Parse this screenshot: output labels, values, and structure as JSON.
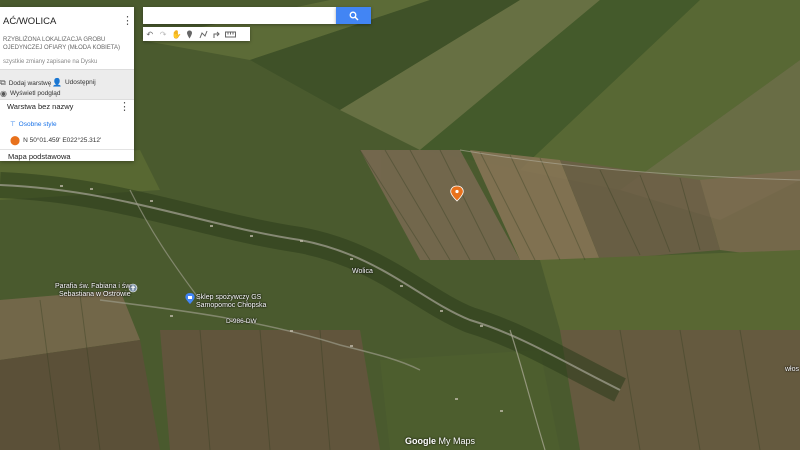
{
  "panel": {
    "title": "AĆ/WOLICA",
    "description_lines": [
      "RZYBLIŻONA LOKALIZACJA GROBU",
      "OJEDYNCZEJ OFIARY (MŁODA KOBIETA)"
    ],
    "saved_status": "szystkie zmiany zapisane na Dysku",
    "add_layer_label": "Dodaj warstwę",
    "share_label": "Udostępnij",
    "preview_label": "Wyświetl podgląd",
    "layer": {
      "name": "Warstwa bez nazwy",
      "style_label": "Osobne style",
      "point_label": "N 50°01.459' E022°25.312'"
    },
    "basemap_label": "Mapa podstawowa"
  },
  "search": {
    "value": "",
    "placeholder": ""
  },
  "toolbar": {
    "tools": [
      {
        "name": "undo-icon",
        "glyph": "↶",
        "enabled": true
      },
      {
        "name": "redo-icon",
        "glyph": "↷",
        "enabled": false
      },
      {
        "name": "hand-pan-icon",
        "glyph": "✋",
        "enabled": true
      },
      {
        "name": "marker-add-icon",
        "glyph": "⚲",
        "enabled": true
      },
      {
        "name": "draw-line-icon",
        "glyph": "ᔕ",
        "enabled": true
      },
      {
        "name": "directions-icon",
        "glyph": "↱",
        "enabled": true
      },
      {
        "name": "ruler-icon",
        "glyph": "▭",
        "enabled": true
      },
      {
        "name": "measure-extra-icon",
        "glyph": "",
        "enabled": true
      }
    ]
  },
  "map_labels": {
    "village": "Wolica",
    "church_line1": "Parafia św. Fabiana i św.",
    "church_line2": "Sebastiana w Ostrowie",
    "shop_line1": "Sklep spożywczy GS",
    "shop_line2": "Samopomoc Chłopska",
    "road_number": "D-986-DW",
    "right_edge": "włos"
  },
  "watermark": {
    "brand": "Google",
    "product": "My Maps"
  },
  "colors": {
    "accent": "#4285f4",
    "marker": "#e8711c",
    "link": "#1a73e8"
  }
}
